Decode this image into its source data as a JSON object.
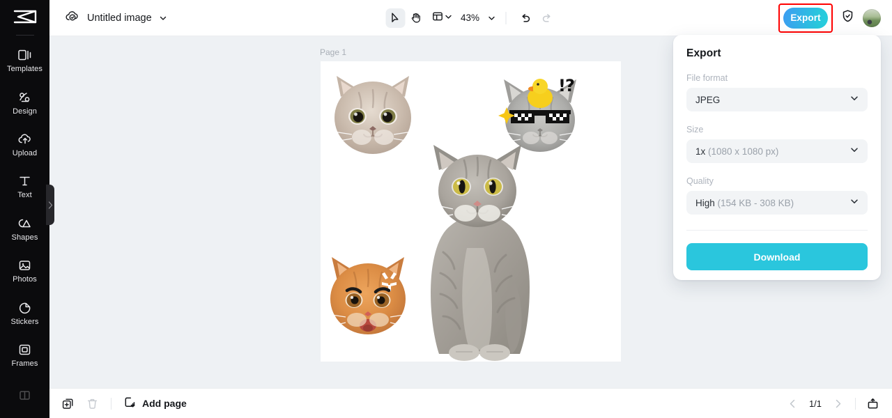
{
  "sidebar": {
    "logo_name": "capcut-logo",
    "items": [
      {
        "label": "Templates",
        "icon": "templates-icon"
      },
      {
        "label": "Design",
        "icon": "design-icon"
      },
      {
        "label": "Upload",
        "icon": "upload-icon"
      },
      {
        "label": "Text",
        "icon": "text-icon"
      },
      {
        "label": "Shapes",
        "icon": "shapes-icon"
      },
      {
        "label": "Photos",
        "icon": "photos-icon"
      },
      {
        "label": "Stickers",
        "icon": "stickers-icon"
      },
      {
        "label": "Frames",
        "icon": "frames-icon"
      },
      {
        "label": "",
        "icon": "background-icon"
      }
    ],
    "collapse_icon": "chevron-right-icon"
  },
  "topbar": {
    "cloud_icon": "cloud-saved-icon",
    "doc_title": "Untitled image",
    "title_chevron": "chevron-down-icon",
    "tools": [
      {
        "name": "select-tool",
        "icon": "cursor-icon",
        "active": true
      },
      {
        "name": "hand-tool",
        "icon": "hand-icon",
        "active": false
      }
    ],
    "layout_icon": "layout-icon",
    "layout_chevron": "chevron-down-icon",
    "zoom_level": "43%",
    "zoom_chevron": "chevron-down-icon",
    "undo_icon": "undo-icon",
    "redo_icon": "redo-icon",
    "export_label": "Export",
    "export_color": "#2ac6dd",
    "highlight_color": "#ff0000",
    "shield_icon": "shield-check-icon",
    "avatar_name": "user-avatar"
  },
  "canvas": {
    "page_label": "Page 1",
    "stickers": [
      {
        "name": "cat-head-cream-sticker"
      },
      {
        "name": "cat-head-sunglasses-sticker"
      },
      {
        "name": "cat-sitting-sticker"
      },
      {
        "name": "cat-head-orange-angry-sticker"
      }
    ],
    "emoji_text": "!?"
  },
  "export_panel": {
    "title": "Export",
    "fields": [
      {
        "label": "File format",
        "value": "JPEG",
        "detail": "",
        "name": "file-format-select"
      },
      {
        "label": "Size",
        "value": "1x",
        "detail": "(1080 x 1080 px)",
        "name": "size-select"
      },
      {
        "label": "Quality",
        "value": "High",
        "detail": "(154 KB - 308 KB)",
        "name": "quality-select"
      }
    ],
    "download_label": "Download",
    "chevron_icon": "chevron-down-icon"
  },
  "bottombar": {
    "duplicate_icon": "duplicate-page-icon",
    "delete_icon": "trash-icon",
    "add_page_label": "Add page",
    "add_page_icon": "add-page-icon",
    "prev_icon": "chevron-left-icon",
    "next_icon": "chevron-right-icon",
    "page_count": "1/1",
    "present_icon": "present-icon"
  }
}
